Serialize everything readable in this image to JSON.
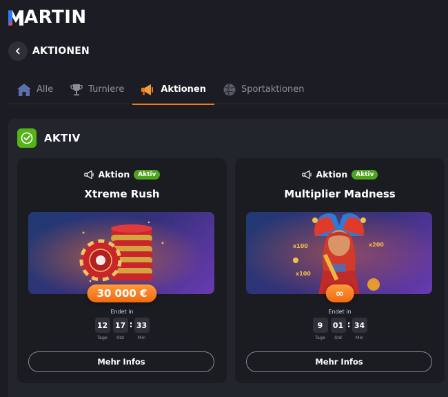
{
  "brand": {
    "name": "ARTIN"
  },
  "header": {
    "title": "AKTIONEN"
  },
  "tabs": [
    {
      "label": "Alle",
      "icon": "house-icon"
    },
    {
      "label": "Turniere",
      "icon": "trophy-icon"
    },
    {
      "label": "Aktionen",
      "icon": "megaphone-icon",
      "active": true
    },
    {
      "label": "Sportaktionen",
      "icon": "ball-icon"
    }
  ],
  "section": {
    "title": "AKTIV"
  },
  "cards": [
    {
      "tag": "Aktion",
      "badge": "Aktiv",
      "title": "Xtreme Rush",
      "prize": "30 000 €",
      "ends_label": "Endet in",
      "timer": {
        "days": "12",
        "days_label": "Tage",
        "hours": "17",
        "hours_label": "Std",
        "minutes": "33",
        "minutes_label": "Min"
      },
      "button": "Mehr Infos"
    },
    {
      "tag": "Aktion",
      "badge": "Aktiv",
      "title": "Multiplier Madness",
      "prize": "∞",
      "ends_label": "Endet in",
      "timer": {
        "days": "9",
        "days_label": "Tage",
        "hours": "01",
        "hours_label": "Std",
        "minutes": "34",
        "minutes_label": "Min"
      },
      "button": "Mehr Infos"
    }
  ],
  "colors": {
    "background": "#1c1d24",
    "accent": "#f07c1a",
    "active_green": "#4ea41d"
  }
}
